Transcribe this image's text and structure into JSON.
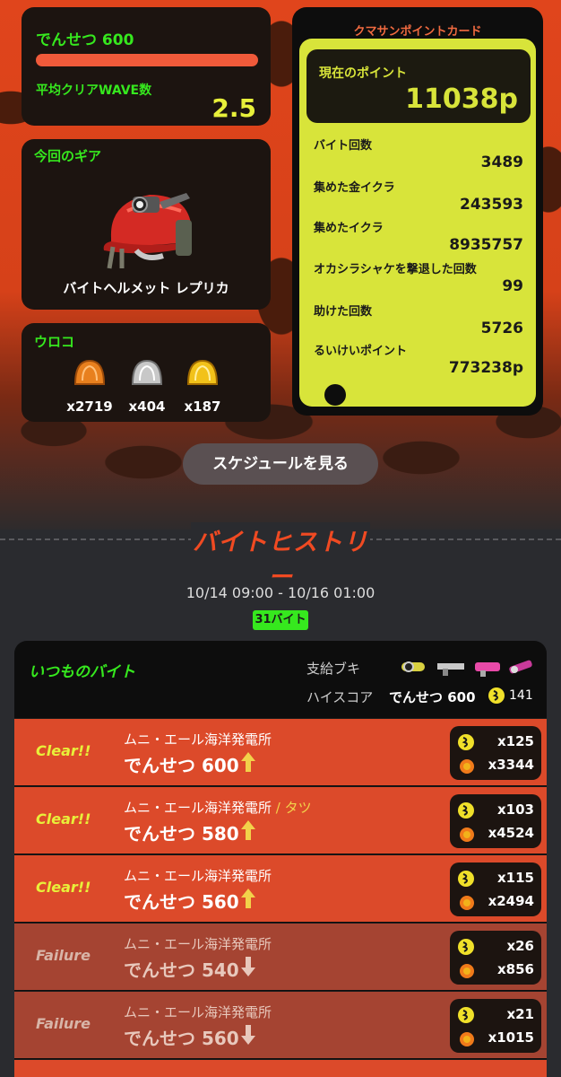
{
  "grade": {
    "label": "でんせつ 600",
    "wave_label": "平均クリアWAVE数",
    "wave_value": "2.5"
  },
  "gear": {
    "title": "今回のギア",
    "name": "バイトヘルメット レプリカ",
    "icon": "helmet-icon"
  },
  "scales": {
    "title": "ウロコ",
    "items": [
      {
        "count": "x2719",
        "color": "#e8801e",
        "icon": "bronze-scale-icon"
      },
      {
        "count": "x404",
        "color": "#c8c8c8",
        "icon": "silver-scale-icon"
      },
      {
        "count": "x187",
        "color": "#f2c21a",
        "icon": "gold-scale-icon"
      }
    ]
  },
  "point_card": {
    "title": "クマサンポイントカード",
    "current_label": "現在のポイント",
    "current_value": "11038p",
    "rows": [
      {
        "label": "バイト回数",
        "value": "3489"
      },
      {
        "label": "集めた金イクラ",
        "value": "243593"
      },
      {
        "label": "集めたイクラ",
        "value": "8935757"
      },
      {
        "label": "オカシラシャケを撃退した回数",
        "value": "99"
      },
      {
        "label": "助けた回数",
        "value": "5726"
      },
      {
        "label": "るいけいポイント",
        "value": "773238p"
      }
    ]
  },
  "schedule_button": "スケジュールを見る",
  "history": {
    "title": "バイトヒストリー",
    "period": "10/14 09:00 - 10/16 01:00",
    "count": "31バイト",
    "header_title": "いつものバイト",
    "weapons_label": "支給ブキ",
    "hiscore_label": "ハイスコア",
    "hiscore_grade": "でんせつ 600",
    "hiscore_eggs": "141",
    "jobs": [
      {
        "result": "Clear!!",
        "stage": "ムニ・エール海洋発電所",
        "extra": "",
        "grade": "でんせつ 600",
        "arrow": "up",
        "golden": "x125",
        "power": "x3344"
      },
      {
        "result": "Clear!!",
        "stage": "ムニ・エール海洋発電所",
        "extra": " / タツ",
        "grade": "でんせつ 580",
        "arrow": "up",
        "golden": "x103",
        "power": "x4524"
      },
      {
        "result": "Clear!!",
        "stage": "ムニ・エール海洋発電所",
        "extra": "",
        "grade": "でんせつ 560",
        "arrow": "up",
        "golden": "x115",
        "power": "x2494"
      },
      {
        "result": "Failure",
        "stage": "ムニ・エール海洋発電所",
        "extra": "",
        "grade": "でんせつ 540",
        "arrow": "down",
        "golden": "x26",
        "power": "x856"
      },
      {
        "result": "Failure",
        "stage": "ムニ・エール海洋発電所",
        "extra": "",
        "grade": "でんせつ 560",
        "arrow": "down",
        "golden": "x21",
        "power": "x1015"
      }
    ]
  },
  "colors": {
    "green": "#36e81e",
    "yellow": "#e8f03a",
    "clear": "#dc4a2a",
    "fail": "#a54432",
    "card": "#d8e43a"
  }
}
